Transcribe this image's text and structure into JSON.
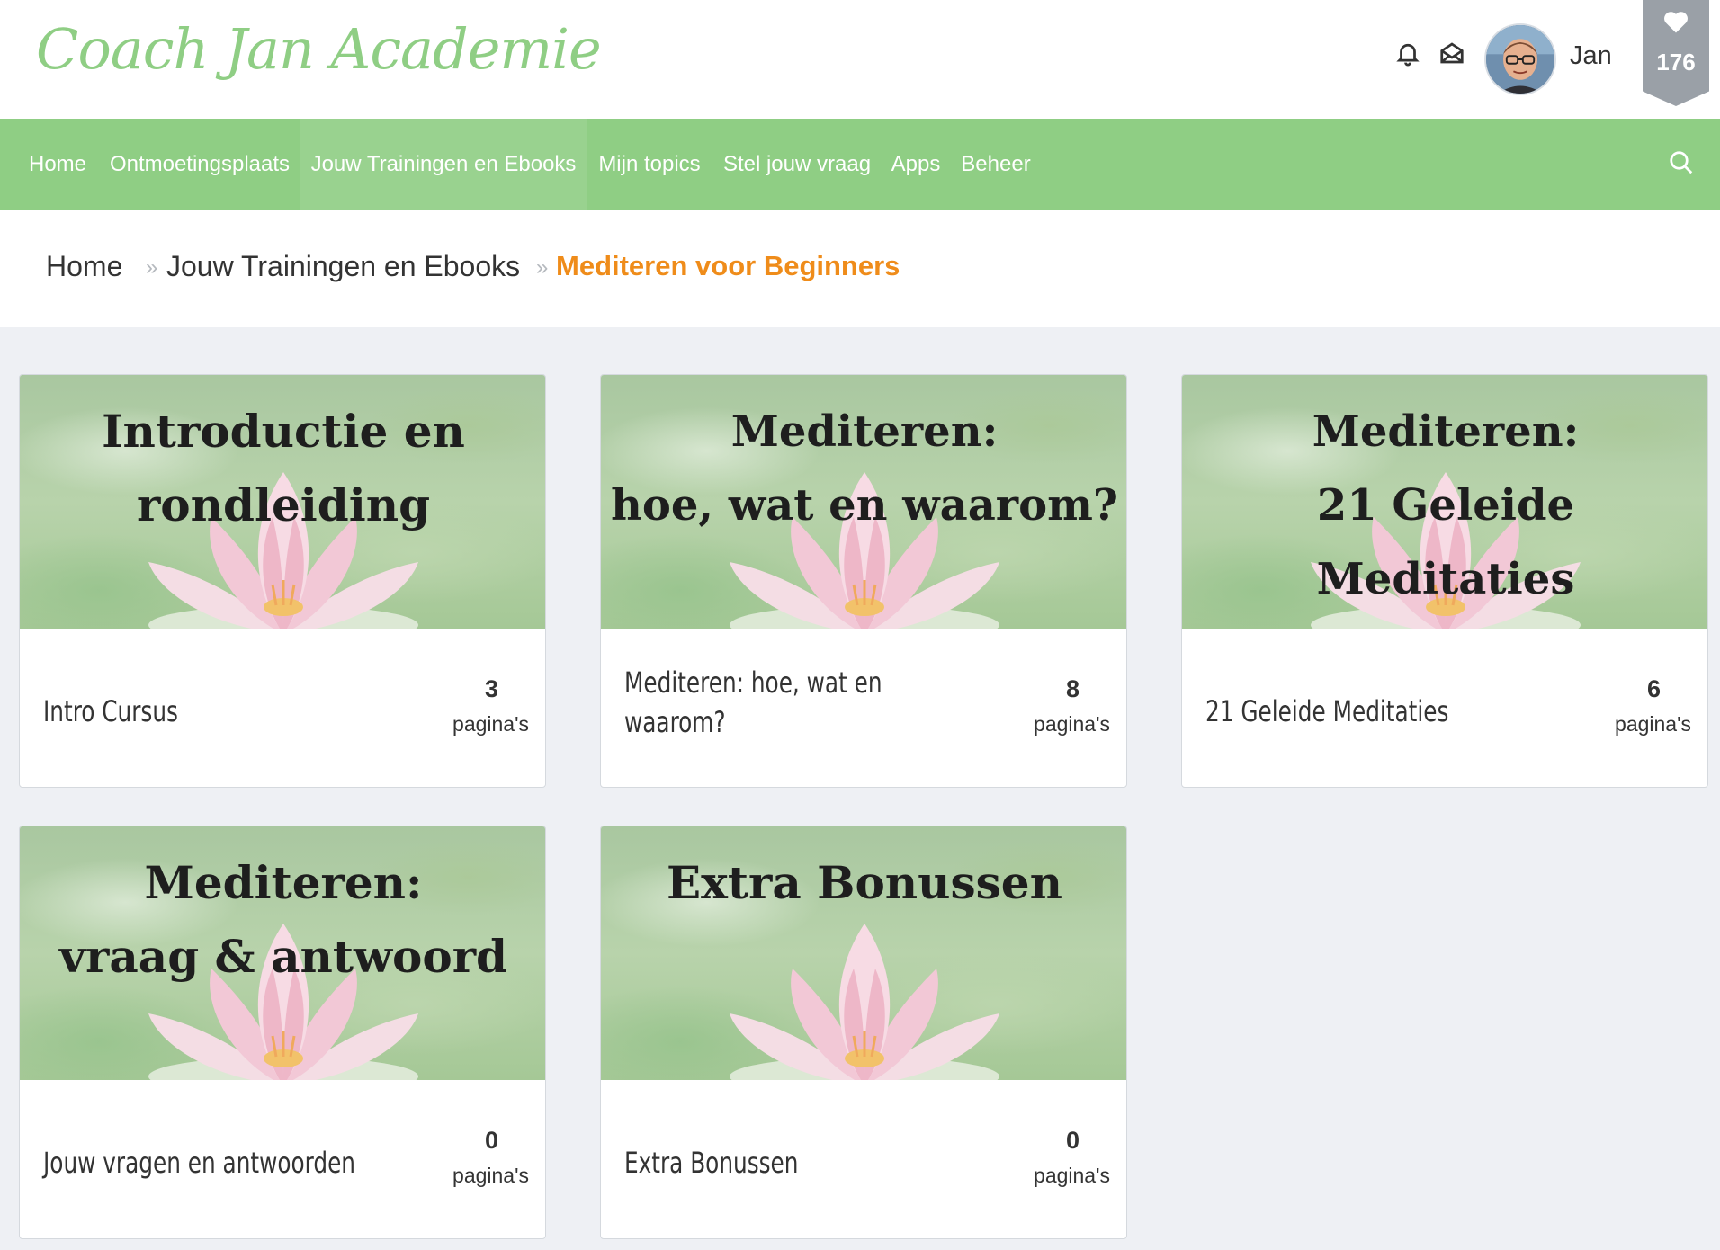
{
  "header": {
    "logo": "Coach Jan Academie",
    "username": "Jan",
    "like_count": "176"
  },
  "icons": {
    "notifications": "bell-icon",
    "messages": "envelope-open-icon",
    "likes": "heart-icon",
    "search": "search-icon"
  },
  "nav": {
    "items": [
      {
        "label": "Home"
      },
      {
        "label": "Ontmoetingsplaats"
      },
      {
        "label": "Jouw Trainingen en Ebooks"
      },
      {
        "label": "Mijn topics"
      },
      {
        "label": "Stel jouw vraag"
      },
      {
        "label": "Apps"
      },
      {
        "label": "Beheer"
      }
    ]
  },
  "breadcrumb": {
    "home": "Home",
    "parent": "Jouw Trainingen en Ebooks",
    "current": "Mediteren voor Beginners",
    "separator": "»"
  },
  "cards": [
    {
      "image_line1": "Introductie en",
      "image_line2": "rondleiding",
      "label": "Intro Cursus",
      "count": "3",
      "unit": "pagina's"
    },
    {
      "image_line1": "Mediteren:",
      "image_line2": "hoe, wat en waarom?",
      "label": "Mediteren: hoe, wat en waarom?",
      "count": "8",
      "unit": "pagina's"
    },
    {
      "image_line1": "Mediteren:",
      "image_line2": "21 Geleide Meditaties",
      "label": "21 Geleide Meditaties",
      "count": "6",
      "unit": "pagina's"
    },
    {
      "image_line1": "Mediteren:",
      "image_line2": "vraag & antwoord",
      "label": "Jouw vragen en antwoorden",
      "count": "0",
      "unit": "pagina's"
    },
    {
      "image_line1": "Extra Bonussen",
      "image_line2": "",
      "label": "Extra Bonussen",
      "count": "0",
      "unit": "pagina's"
    }
  ],
  "colors": {
    "brand_green": "#8fce84",
    "nav_active": "#99d28f",
    "accent_orange": "#ef8c1a",
    "page_background": "#eef0f4",
    "like_badge": "#9aa0a7"
  }
}
